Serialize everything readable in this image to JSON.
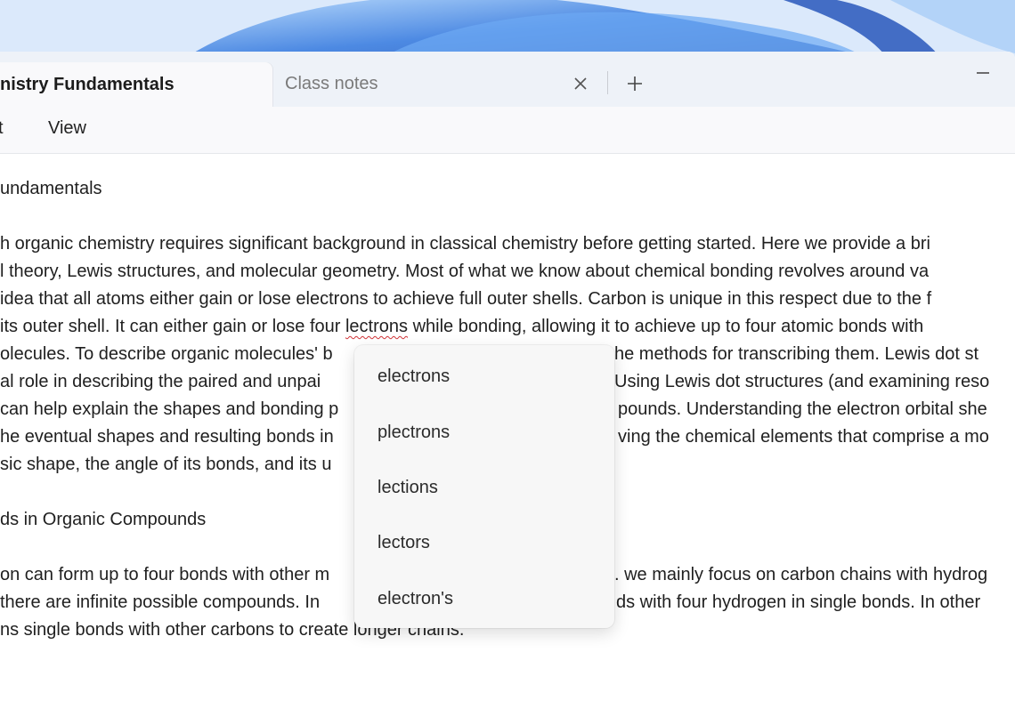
{
  "tabs": [
    {
      "label": "nistry Fundamentals",
      "active": true
    },
    {
      "label": "Class notes",
      "active": false
    }
  ],
  "icons": {
    "tab_close": "close-icon",
    "tab_add": "plus-icon",
    "window_minimize": "minimize-icon"
  },
  "menu": {
    "items": [
      "t",
      "View"
    ]
  },
  "document": {
    "heading": "undamentals",
    "paragraph1": [
      "h organic chemistry requires significant background in classical chemistry before getting started. Here we provide a bri",
      "l theory, Lewis structures, and molecular geometry. Most of what we know about chemical bonding revolves around va",
      " idea that all atoms either gain or lose electrons to achieve full outer shells. Carbon is unique in this respect due to the f",
      "its outer shell. It can either gain or lose four ",
      "lectrons",
      " while bonding, allowing it to achieve up to four atomic bonds with",
      "olecules. To describe organic molecules' b",
      "he methods for transcribing them. Lewis dot st",
      "al role in describing the paired and unpai",
      "Using Lewis dot structures (and examining reso",
      "can help explain the shapes and bonding p",
      "pounds. Understanding the electron orbital she",
      "he eventual shapes and resulting bonds in",
      "ving the chemical elements that comprise a mo",
      "sic shape, the angle of its bonds, and its u"
    ],
    "subheading": "ds in Organic Compounds",
    "paragraph2": [
      "on can form up to four bonds with other m",
      ". we mainly focus on carbon chains with hydrog",
      " there are infinite possible compounds. In",
      "ds with four hydrogen in single bonds. In other",
      "ns single bonds with other carbons to create longer chains."
    ]
  },
  "spell_suggestions": [
    "electrons",
    "plectrons",
    "lections",
    "lectors",
    "electron's"
  ],
  "colors": {
    "accent": "#2a63c9",
    "misspelling_underline": "#d13438"
  }
}
